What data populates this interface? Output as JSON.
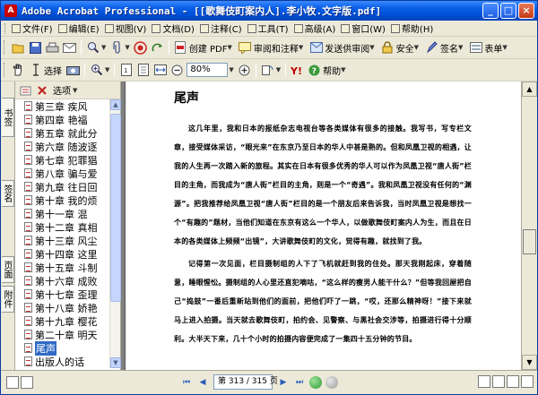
{
  "window": {
    "title": "Adobe Acrobat Professional - [[歌舞伎町案内人].李小牧.文字版.pdf]",
    "app_icon_letter": "A",
    "controls": {
      "minimize": "_",
      "maximize": "□",
      "close": "×"
    }
  },
  "menubar": {
    "items": [
      {
        "label": "文件(F)",
        "icon": "file-icon"
      },
      {
        "label": "编辑(E)",
        "icon": "edit-icon"
      },
      {
        "label": "视图(V)",
        "icon": "view-icon"
      },
      {
        "label": "文档(D)",
        "icon": "document-icon"
      },
      {
        "label": "注释(C)",
        "icon": "comment-icon"
      },
      {
        "label": "工具(T)",
        "icon": "tools-icon"
      },
      {
        "label": "高级(A)",
        "icon": "advanced-icon"
      },
      {
        "label": "窗口(W)",
        "icon": "window-icon"
      },
      {
        "label": "帮助(H)",
        "icon": "help-icon"
      }
    ]
  },
  "toolbar1": {
    "create_pdf_label": "创建 PDF",
    "review_label": "审阅和注释",
    "send_review_label": "发送供审阅",
    "secure_label": "安全",
    "sign_label": "签名",
    "forms_label": "表单"
  },
  "toolbar2": {
    "select_label": "选择",
    "zoom_value": "80%",
    "help_label": "帮助"
  },
  "navtabs": {
    "bookmarks_label": "书签",
    "signatures_label": "签名",
    "pages_label": "页面",
    "attachments_label": "附件"
  },
  "bookmarks": {
    "options_label": "选项",
    "items": [
      {
        "label": "第三章 疾风"
      },
      {
        "label": "第四章 艳福"
      },
      {
        "label": "第五章 就此分"
      },
      {
        "label": "第六章 随波逐"
      },
      {
        "label": "第七章 犯罪猖"
      },
      {
        "label": "第八章 骗与爱"
      },
      {
        "label": "第九章 往日回"
      },
      {
        "label": "第十章 我的烦"
      },
      {
        "label": "第十一章 混"
      },
      {
        "label": "第十二章 真相"
      },
      {
        "label": "第十三章 风尘"
      },
      {
        "label": "第十四章 这里"
      },
      {
        "label": "第十五章 斗制"
      },
      {
        "label": "第十六章 成败"
      },
      {
        "label": "第十七章 歪理"
      },
      {
        "label": "第十八章 娇艳"
      },
      {
        "label": "第十九章 樱花"
      },
      {
        "label": "第二十章 明天"
      },
      {
        "label": "尾声"
      },
      {
        "label": "出版人的话"
      }
    ],
    "selected_index": 18
  },
  "document": {
    "heading": "尾声",
    "paragraphs": [
      "这几年里，我和日本的报纸杂志电视台等各类媒体有很多的接触。我写书，写专栏文章，接受媒体采访，“眼光来”在东京乃至日本的华人中甚是熟的。但和凤凰卫视的相遇，让我的人生再一次踏入新的旅程。其实在日本有很多优秀的华人可以作为凤凰卫视“唐人街”栏目的主角，而我成为“唐人街”栏目的主角，则是一个“奇遇”。我和凤凰卫视没有任何的“渊源”。把我推荐给凤凰卫视“唐人街”栏目的是一个朋友后来告诉我，当时凤凰卫视是想找一个“有趣的”题材，当他们知道在东京有这么一个华人，以做歌舞伎町案内人为生，而且在日本的各类媒体上频频“出镜”，大讲歌舞伎町的文化，觉得有趣，就找到了我。",
      "记得第一次见面，栏目摄制组的人下了飞机就赶到我的住处。那天我刚起床，穿着随意，睡眼惺忪。摄制组的人心里还直犯嘀咕，“这么样的瘦男人能干什么？”但等我回屋把自己“捣鼓”一番后重新站到他们的面前，把他们吓了一跳，“哎，还那么精神呀！”接下来就马上进入拍摄。当天就去歌舞伎町，拍约会、见警察、与黑社会交涉等，拍摄进行得十分顺利。大半天下来，几十个小时的拍摄内容便完成了一集四十五分钟的节目。"
    ]
  },
  "statusbar": {
    "page_field": "第 313 / 315 页",
    "nav": {
      "first": "⏮",
      "prev": "◀",
      "next": "▶",
      "last": "⏭"
    }
  },
  "colors": {
    "title_gradient": "#0a5fe8",
    "selection": "#316ac5",
    "chrome": "#ece9d8",
    "doc_bg": "#808080"
  }
}
